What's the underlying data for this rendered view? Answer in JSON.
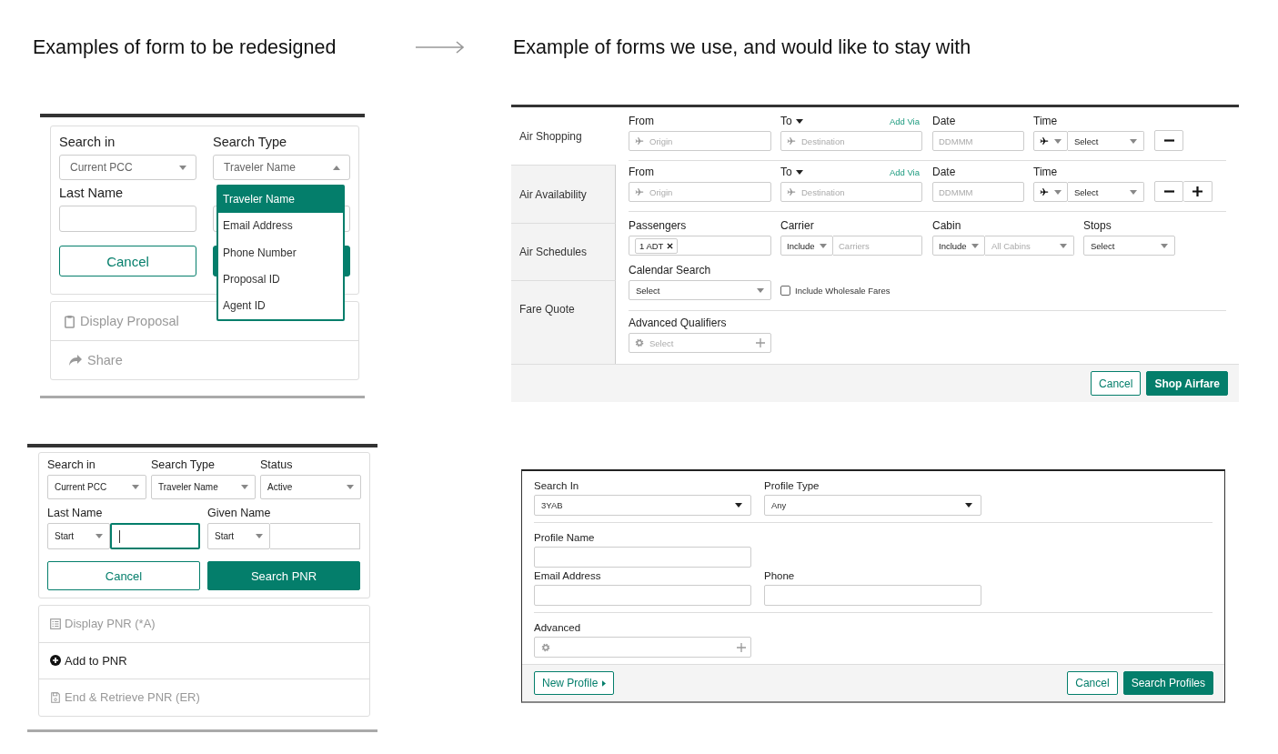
{
  "headings": {
    "left": "Examples of form to be redesigned",
    "right": "Example of forms we use, and would like to stay with"
  },
  "proposal_search": {
    "fields": [
      {
        "label": "Search in",
        "kind": "select",
        "value": "Current PCC",
        "expanded": false
      },
      {
        "label": "Search Type",
        "kind": "select",
        "value": "Traveler Name",
        "expanded": true
      },
      {
        "label": "Last Name",
        "kind": "text"
      },
      {
        "kind": "text"
      }
    ],
    "buttons": [
      {
        "label": "Cancel",
        "kind": "secondary"
      },
      {
        "kind": "primary"
      }
    ],
    "dropdown": [
      {
        "label": "Traveler Name",
        "selected": true
      },
      {
        "label": "Email Address",
        "selected": false
      },
      {
        "label": "Phone Number",
        "selected": false
      },
      {
        "label": "Proposal ID",
        "selected": false
      },
      {
        "label": "Agent ID",
        "selected": false
      }
    ],
    "actions": [
      {
        "label": "Display Proposal",
        "kind": "display",
        "disabled": true
      },
      {
        "label": "Share",
        "kind": "share",
        "disabled": true
      }
    ]
  },
  "pnr_search": {
    "selects": [
      {
        "label": "Search in",
        "value": "Current PCC"
      },
      {
        "label": "Search Type",
        "value": "Traveler Name"
      },
      {
        "label": "Status",
        "value": "Active"
      }
    ],
    "name_fields": [
      {
        "label": "Last Name",
        "mode": "Start",
        "focused": true
      },
      {
        "label": "Given Name",
        "mode": "Start",
        "focused": false
      }
    ],
    "buttons": [
      {
        "label": "Cancel",
        "kind": "secondary"
      },
      {
        "label": "Search PNR",
        "kind": "primary"
      }
    ],
    "actions": [
      {
        "label": "Display PNR (*A)",
        "kind": "display",
        "disabled": true
      },
      {
        "label": "Add to PNR",
        "kind": "add",
        "disabled": false
      },
      {
        "label": "End & Retrieve PNR (ER)",
        "kind": "retrieve",
        "disabled": true
      }
    ]
  },
  "air_search": {
    "tabs": [
      {
        "label": "Air Shopping",
        "selected": true
      },
      {
        "label": "Air Availability",
        "selected": false
      },
      {
        "label": "Air Schedules",
        "selected": false
      },
      {
        "label": "Fare Quote",
        "selected": false
      }
    ],
    "segments": [
      {
        "from_label": "From",
        "from_placeholder": "Origin",
        "to_label": "To",
        "to_placeholder": "Destination",
        "add_via": "Add Via",
        "date_label": "Date",
        "date_placeholder": "DDMMM",
        "time_label": "Time",
        "time_value": "Select",
        "controls": [
          {
            "kind": "remove"
          }
        ]
      },
      {
        "from_label": "From",
        "from_placeholder": "Origin",
        "to_label": "To",
        "to_placeholder": "Destination",
        "add_via": "Add Via",
        "date_label": "Date",
        "date_placeholder": "DDMMM",
        "time_label": "Time",
        "time_value": "Select",
        "controls": [
          {
            "kind": "remove"
          },
          {
            "kind": "add"
          }
        ]
      }
    ],
    "passengers": {
      "label": "Passengers",
      "chips": [
        "1 ADT"
      ]
    },
    "carrier": {
      "label": "Carrier",
      "mode": "Include",
      "placeholder": "Carriers"
    },
    "cabin": {
      "label": "Cabin",
      "mode": "Include",
      "placeholder": "All Cabins"
    },
    "stops": {
      "label": "Stops",
      "value": "Select"
    },
    "calendar": {
      "label": "Calendar Search",
      "value": "Select"
    },
    "wholesale": {
      "label": "Include Wholesale Fares",
      "checked": false
    },
    "qualifiers": {
      "label": "Advanced Qualifiers",
      "placeholder": "Select"
    },
    "buttons": [
      {
        "label": "Cancel",
        "kind": "secondary"
      },
      {
        "label": "Shop Airfare",
        "kind": "primary"
      }
    ]
  },
  "profile_search": {
    "search_in": {
      "label": "Search In",
      "value": "3YAB"
    },
    "profile_type": {
      "label": "Profile Type",
      "value": "Any"
    },
    "profile_name": {
      "label": "Profile Name"
    },
    "email": {
      "label": "Email Address"
    },
    "phone": {
      "label": "Phone"
    },
    "advanced": {
      "label": "Advanced"
    },
    "new_profile": "New Profile",
    "buttons": [
      {
        "label": "Cancel",
        "kind": "secondary"
      },
      {
        "label": "Search Profiles",
        "kind": "primary"
      }
    ]
  }
}
